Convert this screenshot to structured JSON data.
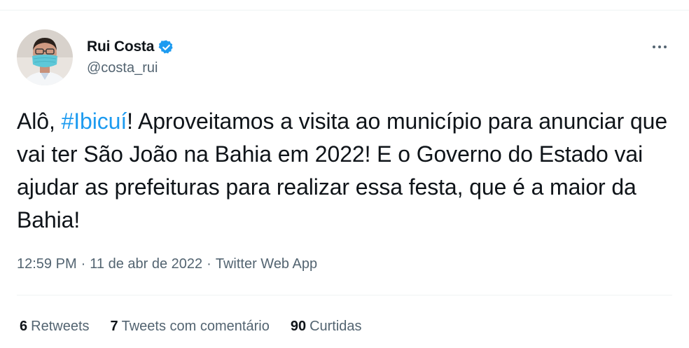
{
  "author": {
    "name": "Rui Costa",
    "handle": "@costa_rui",
    "verified": true
  },
  "tweet": {
    "segments": [
      {
        "text": "Alô, ",
        "hashtag": false
      },
      {
        "text": "#Ibicuí",
        "hashtag": true
      },
      {
        "text": "! Aproveitamos a visita ao município para anunciar que vai ter São João na Bahia em 2022! E o Governo do Estado vai ajudar as prefeituras para realizar essa festa, que é a maior da Bahia!",
        "hashtag": false
      }
    ]
  },
  "meta": {
    "time": "12:59 PM",
    "separator": "·",
    "date": "11 de abr de 2022",
    "source": "Twitter Web App"
  },
  "stats": {
    "retweets_count": "6",
    "retweets_label": "Retweets",
    "quotes_count": "7",
    "quotes_label": "Tweets com comentário",
    "likes_count": "90",
    "likes_label": "Curtidas"
  },
  "colors": {
    "accent": "#1d9bf0",
    "secondary_text": "#536471",
    "primary_text": "#0f1419",
    "divider": "#eff3f4"
  },
  "icons": {
    "verified": "verified-badge-icon",
    "more": "more-options-icon"
  }
}
